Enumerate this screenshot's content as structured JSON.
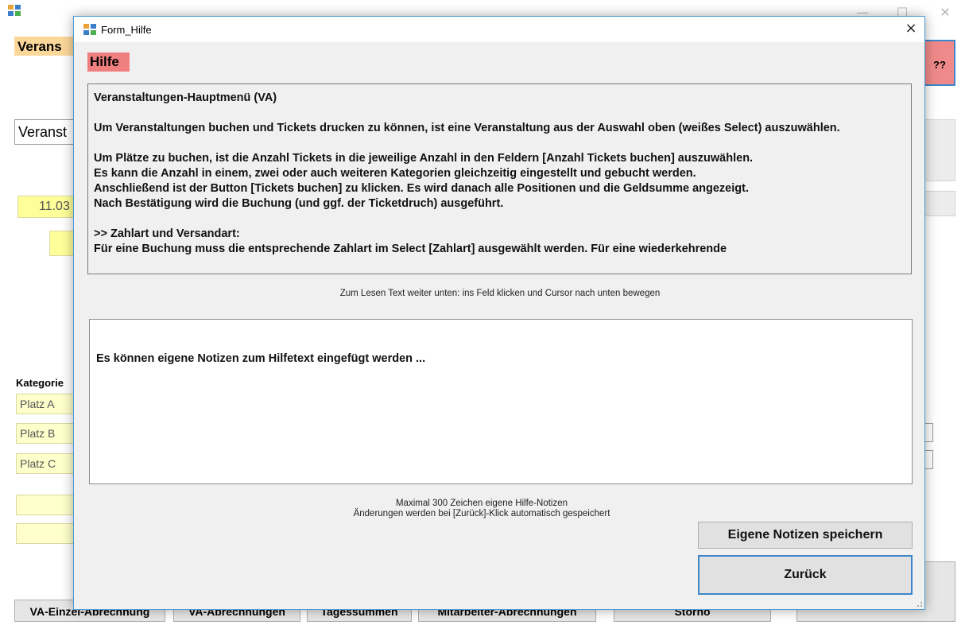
{
  "background": {
    "title_fragment": "Verans",
    "help_button": "??",
    "select_value": "Veranst",
    "date_value": "11.03",
    "categories_label": "Kategorie",
    "platz": [
      "Platz A",
      "Platz B",
      "Platz C"
    ],
    "buttons": [
      "VA-Einzel-Abrechnung",
      "VA-Abrechnungen",
      "Tagessummen",
      "Mitarbeiter-Abrechnungen",
      "Storno"
    ]
  },
  "dialog": {
    "window_title": "Form_Hilfe",
    "close_glyph": "×",
    "heading": "Hilfe",
    "help_paragraphs": [
      "Veranstaltungen-Hauptmenü (VA)",
      "Um Veranstaltungen buchen und Tickets drucken zu können, ist eine Veranstaltung aus der Auswahl oben (weißes Select) auszuwählen.",
      "Um Plätze zu buchen, ist die Anzahl Tickets in die jeweilige Anzahl in den Feldern [Anzahl Tickets buchen] auszuwählen.\nEs kann die Anzahl in einem, zwei oder auch weiteren Kategorien gleichzeitig eingestellt und gebucht werden.\nAnschließend ist der Button [Tickets buchen] zu klicken. Es wird danach alle Positionen und die Geldsumme angezeigt.\nNach Bestätigung wird die Buchung (und ggf. der Ticketdruch) ausgeführt.",
      ">> Zahlart und Versandart:\nFür eine Buchung muss die entsprechende Zahlart im Select [Zahlart] ausgewählt werden. Für eine wiederkehrende"
    ],
    "scroll_hint": "Zum Lesen Text weiter unten:  ins Feld klicken und  Cursor nach unten bewegen",
    "notes_text": "Es können eigene Notizen zum Hilfetext eingefügt werden  ...",
    "notes_info_1": "Maximal 300 Zeichen eigene Hilfe-Notizen",
    "notes_info_2": "Änderungen werden bei [Zurück]-Klick automatisch gespeichert",
    "save_button": "Eigene Notizen speichern",
    "back_button": "Zurück"
  }
}
